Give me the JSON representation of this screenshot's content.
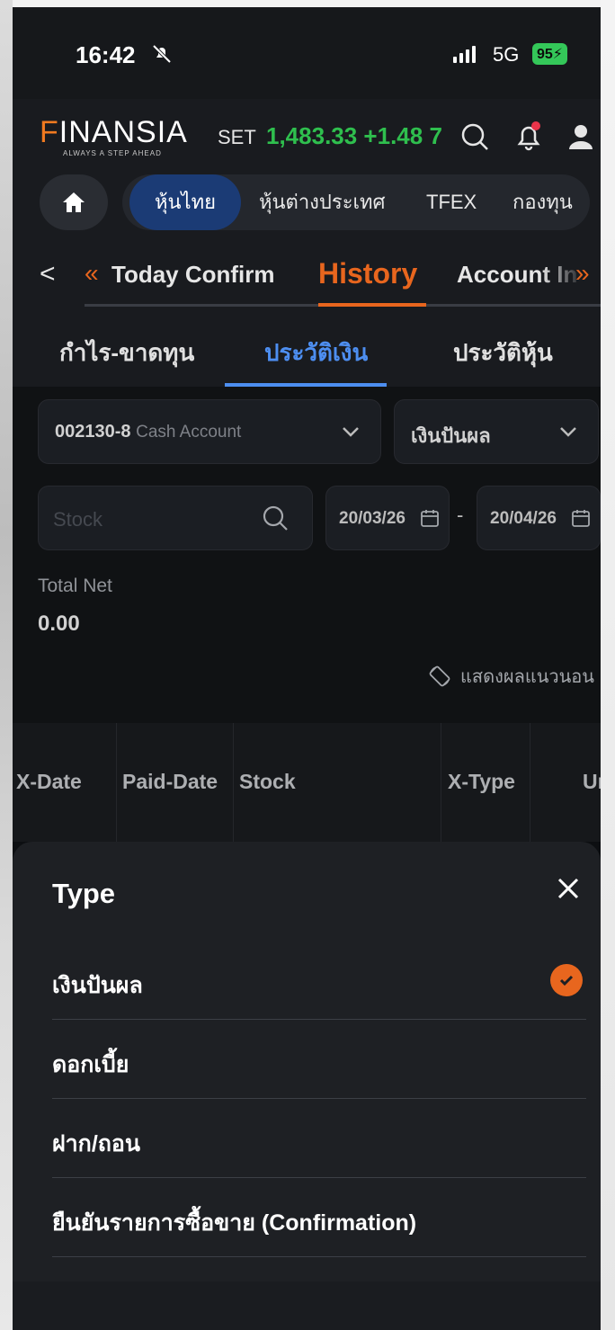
{
  "status_bar": {
    "time": "16:42",
    "network": "5G",
    "battery": "95"
  },
  "header": {
    "logo_text": "INANSIA",
    "logo_initial": "F",
    "tagline": "ALWAYS A STEP AHEAD",
    "index_label": "SET",
    "index_value": "1,483.33 +1.48 7",
    "accent_color": "#e8661e",
    "up_color": "#2fbf4e"
  },
  "market_tabs": [
    "หุ้นไทย",
    "หุ้นต่างประเทศ",
    "TFEX",
    "กองทุน"
  ],
  "sub_nav": {
    "items": [
      "Today Confirm",
      "History",
      "Account In"
    ],
    "active": "History"
  },
  "history_tabs": [
    "กำไร-ขาดทุน",
    "ประวัติเงิน",
    "ประวัติหุ้น"
  ],
  "filters": {
    "account_number": "002130-8",
    "account_type": "Cash Account",
    "type_value": "เงินปันผล",
    "stock_placeholder": "Stock",
    "date_from": "20/03/26",
    "date_separator": "-",
    "date_to": "20/04/26"
  },
  "summary": {
    "total_net_label": "Total Net",
    "total_net_value": "0.00"
  },
  "rotate_label": "แสดงผลแนวนอน",
  "table_headers": [
    "X-Date",
    "Paid-Date",
    "Stock",
    "X-Type",
    "Un"
  ],
  "type_sheet": {
    "title": "Type",
    "options": [
      {
        "label": "เงินปันผล",
        "selected": true
      },
      {
        "label": "ดอกเบี้ย",
        "selected": false
      },
      {
        "label": "ฝาก/ถอน",
        "selected": false
      },
      {
        "label": "ยืนยันรายการซื้อขาย (Confirmation)",
        "selected": false
      }
    ]
  }
}
